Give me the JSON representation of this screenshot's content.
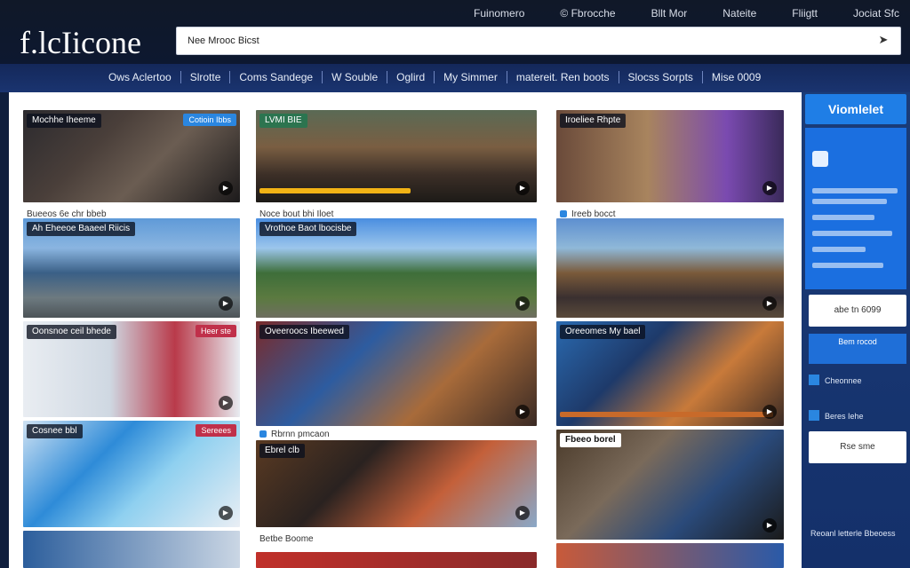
{
  "header": {
    "logo": "f.lcIicone",
    "search_value": "Nee Mrooc Bicst",
    "nav": [
      "Fuinomero",
      "© Fbrocche",
      "Bllt Mor",
      "Nateite",
      "Fliigtt",
      "Jociat Sfc"
    ]
  },
  "categories": [
    "Ows Aclertoo",
    "Slrotte",
    "Coms Sandege",
    "W Souble",
    "Oglird",
    "My Simmer",
    "matereit. Ren boots",
    "Slocss Sorpts",
    "Mise 0009"
  ],
  "sidebar": {
    "button": "Viomlelet",
    "white_box_1": "abe tn 6099",
    "blue_box_title": "Bem rocod",
    "rows": [
      "Cheonnee",
      "Beres Iehe"
    ],
    "white_box_2": "Rse sme",
    "footer": "Reoanl letterle Bbeoess"
  },
  "columns": [
    {
      "cards": [
        {
          "title": "Mochhe Iheeme",
          "badge": "Cotioin Ibbs",
          "caption": "Bueeos 6e chr bbeb"
        },
        {
          "title": "Ah Eheeoe Baaeel Riicis",
          "badge": "",
          "caption": ""
        },
        {
          "title": "Oonsnoe ceil bhede",
          "badge": "Heer ste",
          "caption": ""
        },
        {
          "title": "Cosnee bbl",
          "badge": "Sereees",
          "caption": ""
        },
        {
          "title": "",
          "badge": "",
          "caption": ""
        }
      ]
    },
    {
      "cards": [
        {
          "title": "LVMI BIE",
          "badge": "",
          "caption": "Noce bout bhi Iloet"
        },
        {
          "title": "Vrothoe Baot lbocisbe",
          "badge": "",
          "caption": ""
        },
        {
          "title": "Oveeroocs Ibeewed",
          "badge": "",
          "caption": ""
        },
        {
          "title": "Ebrel clb",
          "badge": "",
          "caption": "Rbrnn pmcaon"
        },
        {
          "title": "",
          "badge": "",
          "caption": "Betbe Boome"
        }
      ]
    },
    {
      "cards": [
        {
          "title": "Iroeliee Rhpte",
          "badge": "",
          "caption": "Ireeb bocct"
        },
        {
          "title": "",
          "badge": "",
          "caption": ""
        },
        {
          "title": "Oreeomes My bael",
          "badge": "",
          "caption": ""
        },
        {
          "title": "Fbeeo borel",
          "badge": "",
          "caption": ""
        },
        {
          "title": "",
          "badge": "",
          "caption": ""
        }
      ]
    }
  ],
  "colors": {
    "topbar": "#101828",
    "catnav": "#14285a",
    "accent": "#1f7ee6",
    "progress": "#f2b315"
  }
}
